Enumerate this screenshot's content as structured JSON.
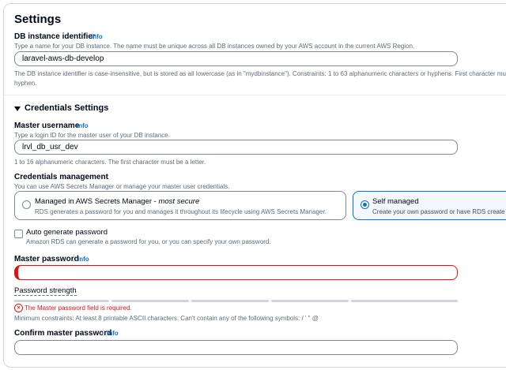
{
  "section_title": "Settings",
  "instance": {
    "label": "DB instance identifier",
    "info": "Info",
    "description": "Type a name for your DB instance. The name must be unique across all DB instances owned by your AWS account in the current AWS Region.",
    "value": "laravel-aws-db-develop",
    "constraint_line1": "The DB instance identifier is case-insensitive, but is stored as all lowercase (as in \"mydbinstance\"). Constraints: 1 to 63 alphanumeric characters or hyphens. First character must be a",
    "constraint_line2": "hyphen."
  },
  "credentials": {
    "title": "Credentials Settings",
    "username_label": "Master username",
    "username_info": "Info",
    "username_desc": "Type a login ID for the master user of your DB instance.",
    "username_value": "lrvl_db_usr_dev",
    "username_constraint": "1 to 16 alphanumeric characters. The first character must be a letter.",
    "management_label": "Credentials management",
    "management_desc": "You can use AWS Secrets Manager or manage your master user credentials.",
    "option_managed_title": "Managed in AWS Secrets Manager - ",
    "option_managed_emph": "most secure",
    "option_managed_desc": "RDS generates a password for you and manages it throughout its lifecycle using AWS Secrets Manager.",
    "option_self_title": "Self managed",
    "option_self_desc": "Create your own password or have RDS create a p",
    "auto_gen_label": "Auto generate password",
    "auto_gen_desc": "Amazon RDS can generate a password for you, or you can specify your own password.",
    "password_label": "Master password",
    "password_info": "Info",
    "password_value": "",
    "strength_label": "Password strength",
    "password_error": "The Master password field is required.",
    "password_constraint": "Minimum constraints: At least 8 printable ASCII characters. Can't contain any of the following symbols: / ' \" @",
    "confirm_label": "Confirm master password",
    "confirm_info": "Info",
    "confirm_value": ""
  },
  "colors": {
    "accent": "#0972d3",
    "error": "#d91515",
    "text": "#000716",
    "muted": "#5f6b7a"
  }
}
